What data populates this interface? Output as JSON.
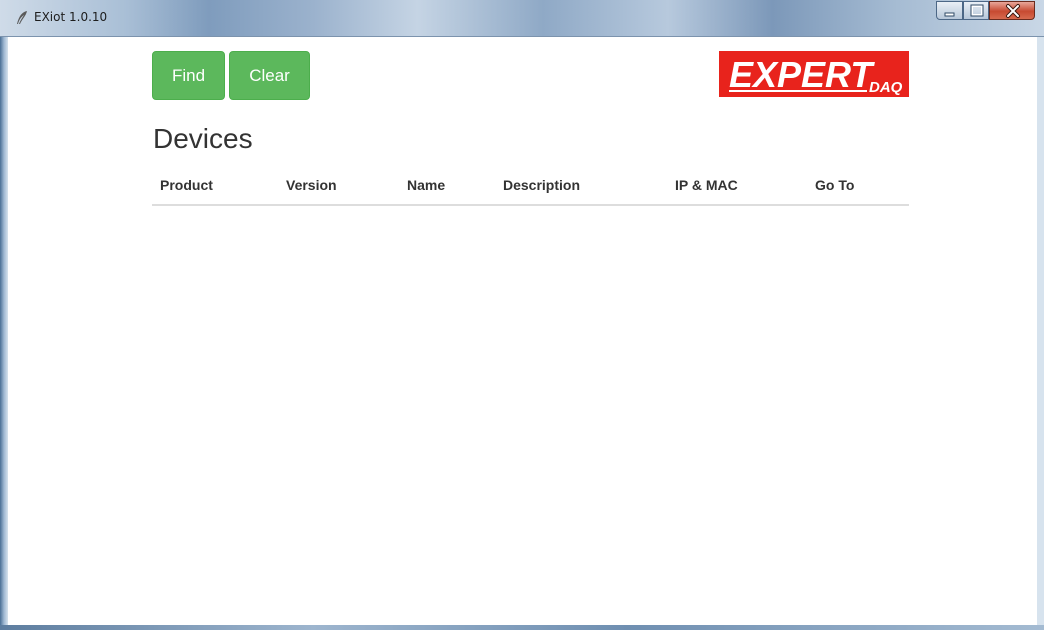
{
  "window": {
    "title": "EXiot 1.0.10"
  },
  "toolbar": {
    "find_label": "Find",
    "clear_label": "Clear"
  },
  "logo": {
    "text_main": "EXPERT",
    "text_sub": "DAQ"
  },
  "page": {
    "title": "Devices"
  },
  "table": {
    "columns": [
      "Product",
      "Version",
      "Name",
      "Description",
      "IP & MAC",
      "Go To"
    ],
    "rows": []
  },
  "colors": {
    "button_green": "#5cb85c",
    "logo_red": "#e8231c"
  },
  "icons": {
    "app": "feather-icon",
    "minimize": "minimize-icon",
    "maximize": "maximize-icon",
    "close": "close-icon"
  }
}
